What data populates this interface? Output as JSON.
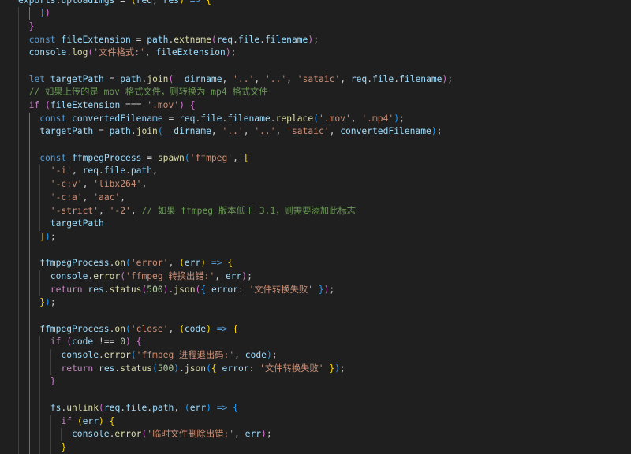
{
  "editor": {
    "language": "javascript",
    "theme_colors": {
      "background": "#1f1f1f",
      "keyword": "#569cd6",
      "control": "#c586c0",
      "variable": "#9cdcfe",
      "function": "#dcdcaa",
      "string": "#ce9178",
      "number": "#b5cea8",
      "comment": "#6a9955",
      "punctuation": "#cccccc",
      "bracket_1": "#ffd700",
      "bracket_2": "#da70d6",
      "bracket_3": "#179fff"
    },
    "lines": [
      {
        "indent": 0,
        "tokens": [
          [
            "var",
            "exports"
          ],
          [
            "p",
            "."
          ],
          [
            "var",
            "uploadImgs"
          ],
          [
            "p",
            " = "
          ],
          [
            "b1",
            "("
          ],
          [
            "var",
            "req"
          ],
          [
            "p",
            ", "
          ],
          [
            "var",
            "res"
          ],
          [
            "b1",
            ")"
          ],
          [
            "kw",
            " =>"
          ],
          [
            "p",
            " "
          ],
          [
            "b1",
            "{"
          ]
        ]
      },
      {
        "indent": 2,
        "tokens": [
          [
            "b3",
            "}"
          ],
          [
            "b2",
            ")"
          ]
        ]
      },
      {
        "indent": 1,
        "tokens": [
          [
            "b2",
            "}"
          ]
        ]
      },
      {
        "indent": 1,
        "tokens": [
          [
            "kw",
            "const"
          ],
          [
            "p",
            " "
          ],
          [
            "var",
            "fileExtension"
          ],
          [
            "p",
            " = "
          ],
          [
            "var",
            "path"
          ],
          [
            "p",
            "."
          ],
          [
            "fn",
            "extname"
          ],
          [
            "b2",
            "("
          ],
          [
            "var",
            "req"
          ],
          [
            "p",
            "."
          ],
          [
            "var",
            "file"
          ],
          [
            "p",
            "."
          ],
          [
            "var",
            "filename"
          ],
          [
            "b2",
            ")"
          ],
          [
            "p",
            ";"
          ]
        ]
      },
      {
        "indent": 1,
        "tokens": [
          [
            "var",
            "console"
          ],
          [
            "p",
            "."
          ],
          [
            "fn",
            "log"
          ],
          [
            "b2",
            "("
          ],
          [
            "str",
            "'文件格式:'"
          ],
          [
            "p",
            ", "
          ],
          [
            "var",
            "fileExtension"
          ],
          [
            "b2",
            ")"
          ],
          [
            "p",
            ";"
          ]
        ]
      },
      {
        "indent": 1,
        "tokens": []
      },
      {
        "indent": 1,
        "tokens": [
          [
            "kw",
            "let"
          ],
          [
            "p",
            " "
          ],
          [
            "var",
            "targetPath"
          ],
          [
            "p",
            " = "
          ],
          [
            "var",
            "path"
          ],
          [
            "p",
            "."
          ],
          [
            "fn",
            "join"
          ],
          [
            "b2",
            "("
          ],
          [
            "var",
            "__dirname"
          ],
          [
            "p",
            ", "
          ],
          [
            "str",
            "'..'"
          ],
          [
            "p",
            ", "
          ],
          [
            "str",
            "'..'"
          ],
          [
            "p",
            ", "
          ],
          [
            "str",
            "'sataic'"
          ],
          [
            "p",
            ", "
          ],
          [
            "var",
            "req"
          ],
          [
            "p",
            "."
          ],
          [
            "var",
            "file"
          ],
          [
            "p",
            "."
          ],
          [
            "var",
            "filename"
          ],
          [
            "b2",
            ")"
          ],
          [
            "p",
            ";"
          ]
        ]
      },
      {
        "indent": 1,
        "tokens": [
          [
            "com",
            "// 如果上传的是 mov 格式文件，则转换为 mp4 格式文件"
          ]
        ]
      },
      {
        "indent": 1,
        "tokens": [
          [
            "ctl",
            "if"
          ],
          [
            "p",
            " "
          ],
          [
            "b2",
            "("
          ],
          [
            "var",
            "fileExtension"
          ],
          [
            "p",
            " === "
          ],
          [
            "str",
            "'.mov'"
          ],
          [
            "b2",
            ")"
          ],
          [
            "p",
            " "
          ],
          [
            "b2",
            "{"
          ]
        ]
      },
      {
        "indent": 2,
        "tokens": [
          [
            "kw",
            "const"
          ],
          [
            "p",
            " "
          ],
          [
            "var",
            "convertedFilename"
          ],
          [
            "p",
            " = "
          ],
          [
            "var",
            "req"
          ],
          [
            "p",
            "."
          ],
          [
            "var",
            "file"
          ],
          [
            "p",
            "."
          ],
          [
            "var",
            "filename"
          ],
          [
            "p",
            "."
          ],
          [
            "fn",
            "replace"
          ],
          [
            "b3",
            "("
          ],
          [
            "str",
            "'.mov'"
          ],
          [
            "p",
            ", "
          ],
          [
            "str",
            "'.mp4'"
          ],
          [
            "b3",
            ")"
          ],
          [
            "p",
            ";"
          ]
        ]
      },
      {
        "indent": 2,
        "tokens": [
          [
            "var",
            "targetPath"
          ],
          [
            "p",
            " = "
          ],
          [
            "var",
            "path"
          ],
          [
            "p",
            "."
          ],
          [
            "fn",
            "join"
          ],
          [
            "b3",
            "("
          ],
          [
            "var",
            "__dirname"
          ],
          [
            "p",
            ", "
          ],
          [
            "str",
            "'..'"
          ],
          [
            "p",
            ", "
          ],
          [
            "str",
            "'..'"
          ],
          [
            "p",
            ", "
          ],
          [
            "str",
            "'sataic'"
          ],
          [
            "p",
            ", "
          ],
          [
            "var",
            "convertedFilename"
          ],
          [
            "b3",
            ")"
          ],
          [
            "p",
            ";"
          ]
        ]
      },
      {
        "indent": 2,
        "tokens": []
      },
      {
        "indent": 2,
        "tokens": [
          [
            "kw",
            "const"
          ],
          [
            "p",
            " "
          ],
          [
            "var",
            "ffmpegProcess"
          ],
          [
            "p",
            " = "
          ],
          [
            "fn",
            "spawn"
          ],
          [
            "b3",
            "("
          ],
          [
            "str",
            "'ffmpeg'"
          ],
          [
            "p",
            ", "
          ],
          [
            "b1",
            "["
          ]
        ]
      },
      {
        "indent": 3,
        "tokens": [
          [
            "str",
            "'-i'"
          ],
          [
            "p",
            ", "
          ],
          [
            "var",
            "req"
          ],
          [
            "p",
            "."
          ],
          [
            "var",
            "file"
          ],
          [
            "p",
            "."
          ],
          [
            "var",
            "path"
          ],
          [
            "p",
            ","
          ]
        ]
      },
      {
        "indent": 3,
        "tokens": [
          [
            "str",
            "'-c:v'"
          ],
          [
            "p",
            ", "
          ],
          [
            "str",
            "'libx264'"
          ],
          [
            "p",
            ","
          ]
        ]
      },
      {
        "indent": 3,
        "tokens": [
          [
            "str",
            "'-c:a'"
          ],
          [
            "p",
            ", "
          ],
          [
            "str",
            "'aac'"
          ],
          [
            "p",
            ","
          ]
        ]
      },
      {
        "indent": 3,
        "tokens": [
          [
            "str",
            "'-strict'"
          ],
          [
            "p",
            ", "
          ],
          [
            "str",
            "'-2'"
          ],
          [
            "p",
            ", "
          ],
          [
            "com",
            "// 如果 ffmpeg 版本低于 3.1，则需要添加此标志"
          ]
        ]
      },
      {
        "indent": 3,
        "tokens": [
          [
            "var",
            "targetPath"
          ]
        ]
      },
      {
        "indent": 2,
        "tokens": [
          [
            "b1",
            "]"
          ],
          [
            "b3",
            ")"
          ],
          [
            "p",
            ";"
          ]
        ]
      },
      {
        "indent": 2,
        "tokens": []
      },
      {
        "indent": 2,
        "tokens": [
          [
            "var",
            "ffmpegProcess"
          ],
          [
            "p",
            "."
          ],
          [
            "fn",
            "on"
          ],
          [
            "b3",
            "("
          ],
          [
            "str",
            "'error'"
          ],
          [
            "p",
            ", "
          ],
          [
            "b1",
            "("
          ],
          [
            "var",
            "err"
          ],
          [
            "b1",
            ")"
          ],
          [
            "kw",
            " =>"
          ],
          [
            "p",
            " "
          ],
          [
            "b1",
            "{"
          ]
        ]
      },
      {
        "indent": 3,
        "tokens": [
          [
            "var",
            "console"
          ],
          [
            "p",
            "."
          ],
          [
            "fn",
            "error"
          ],
          [
            "b2",
            "("
          ],
          [
            "str",
            "'ffmpeg 转换出错:'"
          ],
          [
            "p",
            ", "
          ],
          [
            "var",
            "err"
          ],
          [
            "b2",
            ")"
          ],
          [
            "p",
            ";"
          ]
        ]
      },
      {
        "indent": 3,
        "tokens": [
          [
            "ctl",
            "return"
          ],
          [
            "p",
            " "
          ],
          [
            "var",
            "res"
          ],
          [
            "p",
            "."
          ],
          [
            "fn",
            "status"
          ],
          [
            "b2",
            "("
          ],
          [
            "num",
            "500"
          ],
          [
            "b2",
            ")"
          ],
          [
            "p",
            "."
          ],
          [
            "fn",
            "json"
          ],
          [
            "b2",
            "("
          ],
          [
            "b3",
            "{"
          ],
          [
            "p",
            " "
          ],
          [
            "var",
            "error"
          ],
          [
            "p",
            ": "
          ],
          [
            "str",
            "'文件转换失败'"
          ],
          [
            "p",
            " "
          ],
          [
            "b3",
            "}"
          ],
          [
            "b2",
            ")"
          ],
          [
            "p",
            ";"
          ]
        ]
      },
      {
        "indent": 2,
        "tokens": [
          [
            "b1",
            "}"
          ],
          [
            "b3",
            ")"
          ],
          [
            "p",
            ";"
          ]
        ]
      },
      {
        "indent": 2,
        "tokens": []
      },
      {
        "indent": 2,
        "tokens": [
          [
            "var",
            "ffmpegProcess"
          ],
          [
            "p",
            "."
          ],
          [
            "fn",
            "on"
          ],
          [
            "b3",
            "("
          ],
          [
            "str",
            "'close'"
          ],
          [
            "p",
            ", "
          ],
          [
            "b1",
            "("
          ],
          [
            "var",
            "code"
          ],
          [
            "b1",
            ")"
          ],
          [
            "kw",
            " =>"
          ],
          [
            "p",
            " "
          ],
          [
            "b1",
            "{"
          ]
        ]
      },
      {
        "indent": 3,
        "tokens": [
          [
            "ctl",
            "if"
          ],
          [
            "p",
            " "
          ],
          [
            "b2",
            "("
          ],
          [
            "var",
            "code"
          ],
          [
            "p",
            " !== "
          ],
          [
            "num",
            "0"
          ],
          [
            "b2",
            ")"
          ],
          [
            "p",
            " "
          ],
          [
            "b2",
            "{"
          ]
        ]
      },
      {
        "indent": 4,
        "tokens": [
          [
            "var",
            "console"
          ],
          [
            "p",
            "."
          ],
          [
            "fn",
            "error"
          ],
          [
            "b3",
            "("
          ],
          [
            "str",
            "'ffmpeg 进程退出码:'"
          ],
          [
            "p",
            ", "
          ],
          [
            "var",
            "code"
          ],
          [
            "b3",
            ")"
          ],
          [
            "p",
            ";"
          ]
        ]
      },
      {
        "indent": 4,
        "tokens": [
          [
            "ctl",
            "return"
          ],
          [
            "p",
            " "
          ],
          [
            "var",
            "res"
          ],
          [
            "p",
            "."
          ],
          [
            "fn",
            "status"
          ],
          [
            "b3",
            "("
          ],
          [
            "num",
            "500"
          ],
          [
            "b3",
            ")"
          ],
          [
            "p",
            "."
          ],
          [
            "fn",
            "json"
          ],
          [
            "b3",
            "("
          ],
          [
            "b1",
            "{"
          ],
          [
            "p",
            " "
          ],
          [
            "var",
            "error"
          ],
          [
            "p",
            ": "
          ],
          [
            "str",
            "'文件转换失败'"
          ],
          [
            "p",
            " "
          ],
          [
            "b1",
            "}"
          ],
          [
            "b3",
            ")"
          ],
          [
            "p",
            ";"
          ]
        ]
      },
      {
        "indent": 3,
        "tokens": [
          [
            "b2",
            "}"
          ]
        ]
      },
      {
        "indent": 3,
        "tokens": []
      },
      {
        "indent": 3,
        "tokens": [
          [
            "var",
            "fs"
          ],
          [
            "p",
            "."
          ],
          [
            "fn",
            "unlink"
          ],
          [
            "b2",
            "("
          ],
          [
            "var",
            "req"
          ],
          [
            "p",
            "."
          ],
          [
            "var",
            "file"
          ],
          [
            "p",
            "."
          ],
          [
            "var",
            "path"
          ],
          [
            "p",
            ", "
          ],
          [
            "b3",
            "("
          ],
          [
            "var",
            "err"
          ],
          [
            "b3",
            ")"
          ],
          [
            "kw",
            " =>"
          ],
          [
            "p",
            " "
          ],
          [
            "b3",
            "{"
          ]
        ]
      },
      {
        "indent": 4,
        "tokens": [
          [
            "ctl",
            "if"
          ],
          [
            "p",
            " "
          ],
          [
            "b1",
            "("
          ],
          [
            "var",
            "err"
          ],
          [
            "b1",
            ")"
          ],
          [
            "p",
            " "
          ],
          [
            "b1",
            "{"
          ]
        ]
      },
      {
        "indent": 5,
        "tokens": [
          [
            "var",
            "console"
          ],
          [
            "p",
            "."
          ],
          [
            "fn",
            "error"
          ],
          [
            "b2",
            "("
          ],
          [
            "str",
            "'临时文件删除出错:'"
          ],
          [
            "p",
            ", "
          ],
          [
            "var",
            "err"
          ],
          [
            "b2",
            ")"
          ],
          [
            "p",
            ";"
          ]
        ]
      },
      {
        "indent": 4,
        "tokens": [
          [
            "b1",
            "}"
          ]
        ]
      }
    ]
  }
}
